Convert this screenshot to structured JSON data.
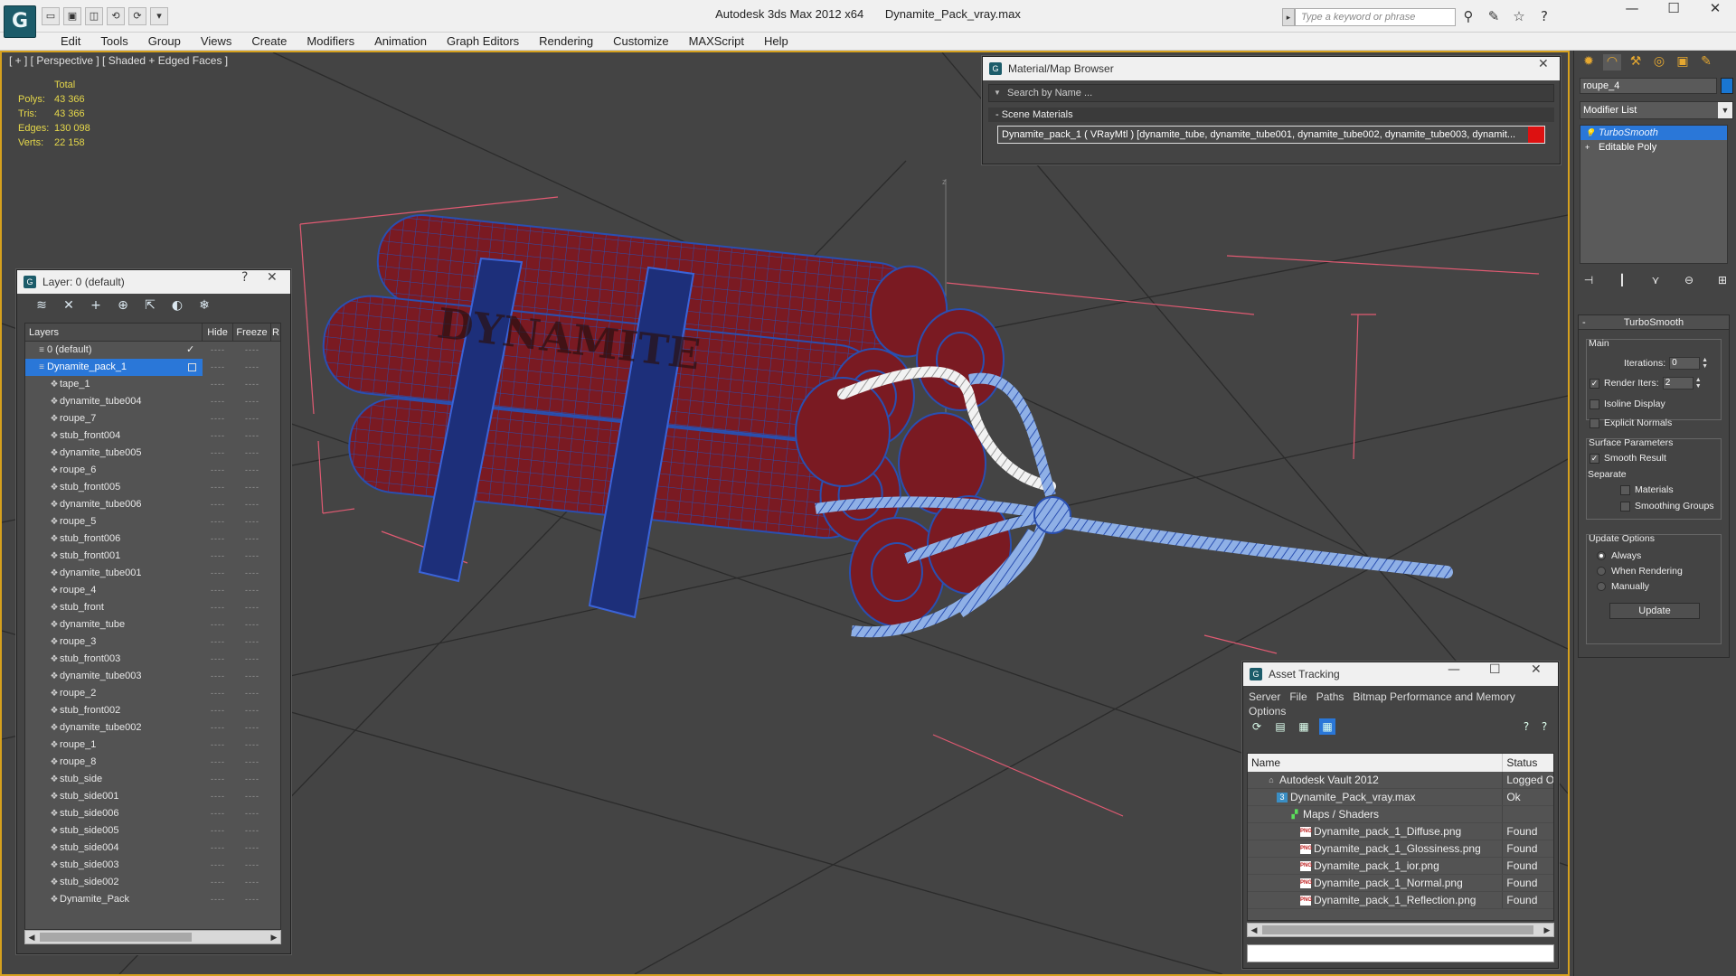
{
  "app": {
    "logo_glyph": "G",
    "title": "Autodesk 3ds Max  2012 x64",
    "file": "Dynamite_Pack_vray.max",
    "search_placeholder": "Type a keyword or phrase",
    "quick_access": [
      "▭",
      "▣",
      "◫",
      "⟲",
      "⟳",
      "▾"
    ],
    "title_icons": [
      "⚲",
      "✎",
      "☆",
      "?"
    ],
    "window_controls": [
      "—",
      "☐",
      "✕"
    ]
  },
  "menu": [
    "Edit",
    "Tools",
    "Group",
    "Views",
    "Create",
    "Modifiers",
    "Animation",
    "Graph Editors",
    "Rendering",
    "Customize",
    "MAXScript",
    "Help"
  ],
  "viewport": {
    "label": "[ + ] [ Perspective ] [ Shaded + Edged Faces ]",
    "stats": {
      "header": "Total",
      "rows": [
        {
          "label": "Polys:",
          "value": "43 366"
        },
        {
          "label": "Tris:",
          "value": "43 366"
        },
        {
          "label": "Edges:",
          "value": "130 098"
        },
        {
          "label": "Verts:",
          "value": "22 158"
        }
      ]
    },
    "colors": {
      "border": "#d6a11e",
      "stat_text": "#e6d84a",
      "dynamite": "#7a1a22",
      "wire": "#2a4fb0",
      "gizmo": "#e05a72"
    },
    "label_text_on_stick": "DYNAMITE"
  },
  "layer_panel": {
    "title": "Layer: 0 (default)",
    "help": "?",
    "close": "✕",
    "toolbar_icons": [
      "new-layer",
      "delete",
      "add",
      "select",
      "highlight",
      "hide-all",
      "freeze-all"
    ],
    "toolbar_glyphs": [
      "≋",
      "✕",
      "+",
      "⊕",
      "⇱",
      "◐",
      "❄"
    ],
    "columns": [
      "Layers",
      "Hide",
      "Freeze",
      "R"
    ],
    "rows": [
      {
        "name": "0 (default)",
        "level": 0,
        "icon": "≡",
        "checked": true
      },
      {
        "name": "Dynamite_pack_1",
        "level": 0,
        "icon": "≡",
        "selected": true
      },
      {
        "name": "tape_1",
        "level": 1,
        "icon": "❖"
      },
      {
        "name": "dynamite_tube004",
        "level": 1,
        "icon": "❖"
      },
      {
        "name": "roupe_7",
        "level": 1,
        "icon": "❖"
      },
      {
        "name": "stub_front004",
        "level": 1,
        "icon": "❖"
      },
      {
        "name": "dynamite_tube005",
        "level": 1,
        "icon": "❖"
      },
      {
        "name": "roupe_6",
        "level": 1,
        "icon": "❖"
      },
      {
        "name": "stub_front005",
        "level": 1,
        "icon": "❖"
      },
      {
        "name": "dynamite_tube006",
        "level": 1,
        "icon": "❖"
      },
      {
        "name": "roupe_5",
        "level": 1,
        "icon": "❖"
      },
      {
        "name": "stub_front006",
        "level": 1,
        "icon": "❖"
      },
      {
        "name": "stub_front001",
        "level": 1,
        "icon": "❖"
      },
      {
        "name": "dynamite_tube001",
        "level": 1,
        "icon": "❖"
      },
      {
        "name": "roupe_4",
        "level": 1,
        "icon": "❖"
      },
      {
        "name": "stub_front",
        "level": 1,
        "icon": "❖"
      },
      {
        "name": "dynamite_tube",
        "level": 1,
        "icon": "❖"
      },
      {
        "name": "roupe_3",
        "level": 1,
        "icon": "❖"
      },
      {
        "name": "stub_front003",
        "level": 1,
        "icon": "❖"
      },
      {
        "name": "dynamite_tube003",
        "level": 1,
        "icon": "❖"
      },
      {
        "name": "roupe_2",
        "level": 1,
        "icon": "❖"
      },
      {
        "name": "stub_front002",
        "level": 1,
        "icon": "❖"
      },
      {
        "name": "dynamite_tube002",
        "level": 1,
        "icon": "❖"
      },
      {
        "name": "roupe_1",
        "level": 1,
        "icon": "❖"
      },
      {
        "name": "roupe_8",
        "level": 1,
        "icon": "❖"
      },
      {
        "name": "stub_side",
        "level": 1,
        "icon": "❖"
      },
      {
        "name": "stub_side001",
        "level": 1,
        "icon": "❖"
      },
      {
        "name": "stub_side006",
        "level": 1,
        "icon": "❖"
      },
      {
        "name": "stub_side005",
        "level": 1,
        "icon": "❖"
      },
      {
        "name": "stub_side004",
        "level": 1,
        "icon": "❖"
      },
      {
        "name": "stub_side003",
        "level": 1,
        "icon": "❖"
      },
      {
        "name": "stub_side002",
        "level": 1,
        "icon": "❖"
      },
      {
        "name": "Dynamite_Pack",
        "level": 1,
        "icon": "❖"
      }
    ],
    "cell_mark": "----",
    "check_mark": "✓",
    "scroll_left": "◀",
    "scroll_right": "▶"
  },
  "material_browser": {
    "title": "Material/Map Browser",
    "close": "✕",
    "search_placeholder": "Search by Name ...",
    "group": "- Scene Materials",
    "item": "Dynamite_pack_1  ( VRayMtl )  [dynamite_tube, dynamite_tube001, dynamite_tube002, dynamite_tube003, dynamit..."
  },
  "command_panel": {
    "tabs": [
      "✹",
      "◠",
      "⚒",
      "◎",
      "▣",
      "✎"
    ],
    "object_name": "roupe_4",
    "object_color": "#1976d2",
    "modifier_list": "Modifier List",
    "stack": [
      {
        "name": "TurboSmooth",
        "selected": true,
        "icon": "💡"
      },
      {
        "name": "Editable Poly",
        "selected": false,
        "icon": "+"
      }
    ],
    "stack_tools": [
      "⊣",
      "┃",
      "⋎",
      "⊖",
      "⊞"
    ],
    "rollout_title": "TurboSmooth",
    "main_group": "Main",
    "iterations_label": "Iterations:",
    "iterations_value": "0",
    "render_iters_label": "Render Iters:",
    "render_iters_value": "2",
    "render_iters_checked": true,
    "isoline": "Isoline Display",
    "explicit": "Explicit Normals",
    "surface_group": "Surface Parameters",
    "smooth_result": "Smooth Result",
    "separate": "Separate",
    "materials": "Materials",
    "smoothing_groups": "Smoothing Groups",
    "update_group": "Update Options",
    "always": "Always",
    "when_rendering": "When Rendering",
    "manually": "Manually",
    "update_btn": "Update"
  },
  "asset_tracking": {
    "title": "Asset Tracking",
    "controls": [
      "—",
      "☐",
      "✕"
    ],
    "menu": [
      "Server",
      "File",
      "Paths",
      "Bitmap Performance and Memory"
    ],
    "menu2": "Options",
    "tool_glyphs": [
      "⟳",
      "▤",
      "▦",
      "▦"
    ],
    "help_glyphs": [
      "?",
      "?"
    ],
    "columns": [
      "Name",
      "Status"
    ],
    "rows": [
      {
        "name": "Autodesk Vault 2012",
        "status": "Logged O",
        "indent": 20,
        "icon": "vault",
        "glyph": "⌂"
      },
      {
        "name": "Dynamite_Pack_vray.max",
        "status": "Ok",
        "indent": 32,
        "icon": "max",
        "glyph": "3"
      },
      {
        "name": "Maps / Shaders",
        "status": "",
        "indent": 46,
        "icon": "maps",
        "glyph": "▞"
      },
      {
        "name": "Dynamite_pack_1_Diffuse.png",
        "status": "Found",
        "indent": 58,
        "icon": "png",
        "glyph": "PNG"
      },
      {
        "name": "Dynamite_pack_1_Glossiness.png",
        "status": "Found",
        "indent": 58,
        "icon": "png",
        "glyph": "PNG"
      },
      {
        "name": "Dynamite_pack_1_ior.png",
        "status": "Found",
        "indent": 58,
        "icon": "png",
        "glyph": "PNG"
      },
      {
        "name": "Dynamite_pack_1_Normal.png",
        "status": "Found",
        "indent": 58,
        "icon": "png",
        "glyph": "PNG"
      },
      {
        "name": "Dynamite_pack_1_Reflection.png",
        "status": "Found",
        "indent": 58,
        "icon": "png",
        "glyph": "PNG"
      }
    ],
    "scroll_left": "◀",
    "scroll_right": "▶"
  }
}
